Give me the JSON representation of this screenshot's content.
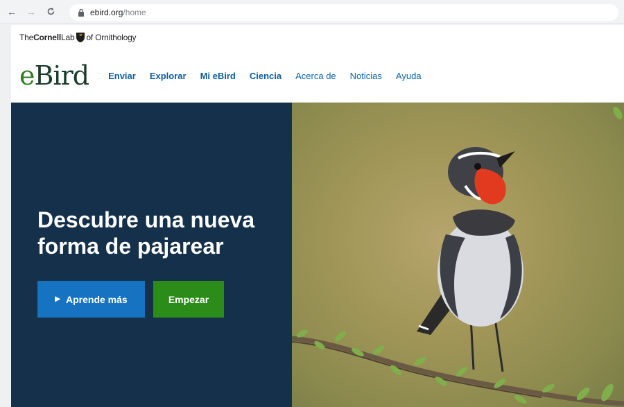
{
  "browser": {
    "url_host": "ebird.org",
    "url_path": "/home"
  },
  "cornell": {
    "the": "The",
    "cornell": "Cornell",
    "lab": "Lab",
    "of_ornithology": "of Ornithology"
  },
  "brand": {
    "e": "e",
    "bird": "Bird"
  },
  "nav": {
    "items": [
      {
        "label": "Enviar"
      },
      {
        "label": "Explorar"
      },
      {
        "label": "Mi eBird"
      },
      {
        "label": "Ciencia"
      },
      {
        "label": "Acerca de"
      },
      {
        "label": "Noticias"
      },
      {
        "label": "Ayuda"
      }
    ]
  },
  "hero": {
    "headline_line1": "Descubre una nueva",
    "headline_line2": "forma de pajarear",
    "learn_label": "Aprende más",
    "start_label": "Empezar"
  },
  "colors": {
    "hero_panel": "#14304a",
    "learn_button": "#1573c1",
    "start_button": "#2c8c1a",
    "nav_link": "#0b64a8"
  }
}
